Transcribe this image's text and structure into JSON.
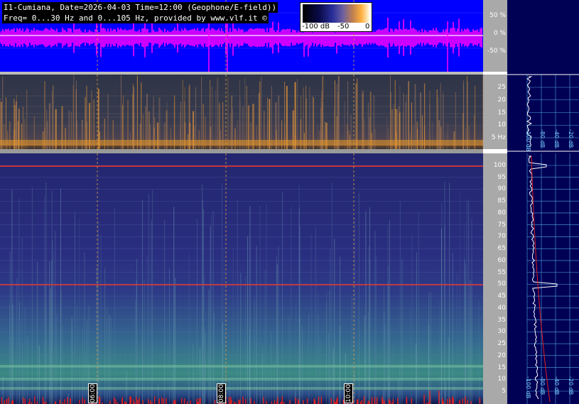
{
  "header": {
    "line1": "I1-Cumiana, Date=2026-04-03 Time=12:00 (Geophone/E-field))",
    "line2": "Freq= 0...30 Hz and 0...105 Hz, provided by www.vlf.it ©"
  },
  "colorbar": {
    "labels": [
      "-100 dB",
      "-50",
      "0"
    ]
  },
  "waveform_axis": {
    "ticks": [
      "50 %",
      "0 %",
      "-50 %"
    ]
  },
  "low_freq_axis": {
    "ticks": [
      "25",
      "20",
      "15",
      "10",
      "5 Hz"
    ]
  },
  "high_freq_axis": {
    "ticks": [
      "100",
      "95",
      "90",
      "85",
      "80",
      "75",
      "70",
      "65",
      "60",
      "55",
      "50",
      "45",
      "40",
      "35",
      "30",
      "25",
      "20",
      "15",
      "10",
      "5"
    ]
  },
  "time_marks": [
    "06:00",
    "08:00",
    "10:00"
  ],
  "profile_db_labels": {
    "upper": [
      "-100 dB",
      "-80 dB",
      "-40 dB",
      "-20 dB"
    ],
    "lower": [
      "-100 dB",
      "-80 dB",
      "-40 dB",
      "-20 dB"
    ]
  },
  "colors": {
    "waveform_bg": "#0000ff",
    "waveform_trace": "#ff00ff",
    "hum_line": "#e03030",
    "profile_bg": "#000055",
    "grid": "#4fa8e0"
  }
}
